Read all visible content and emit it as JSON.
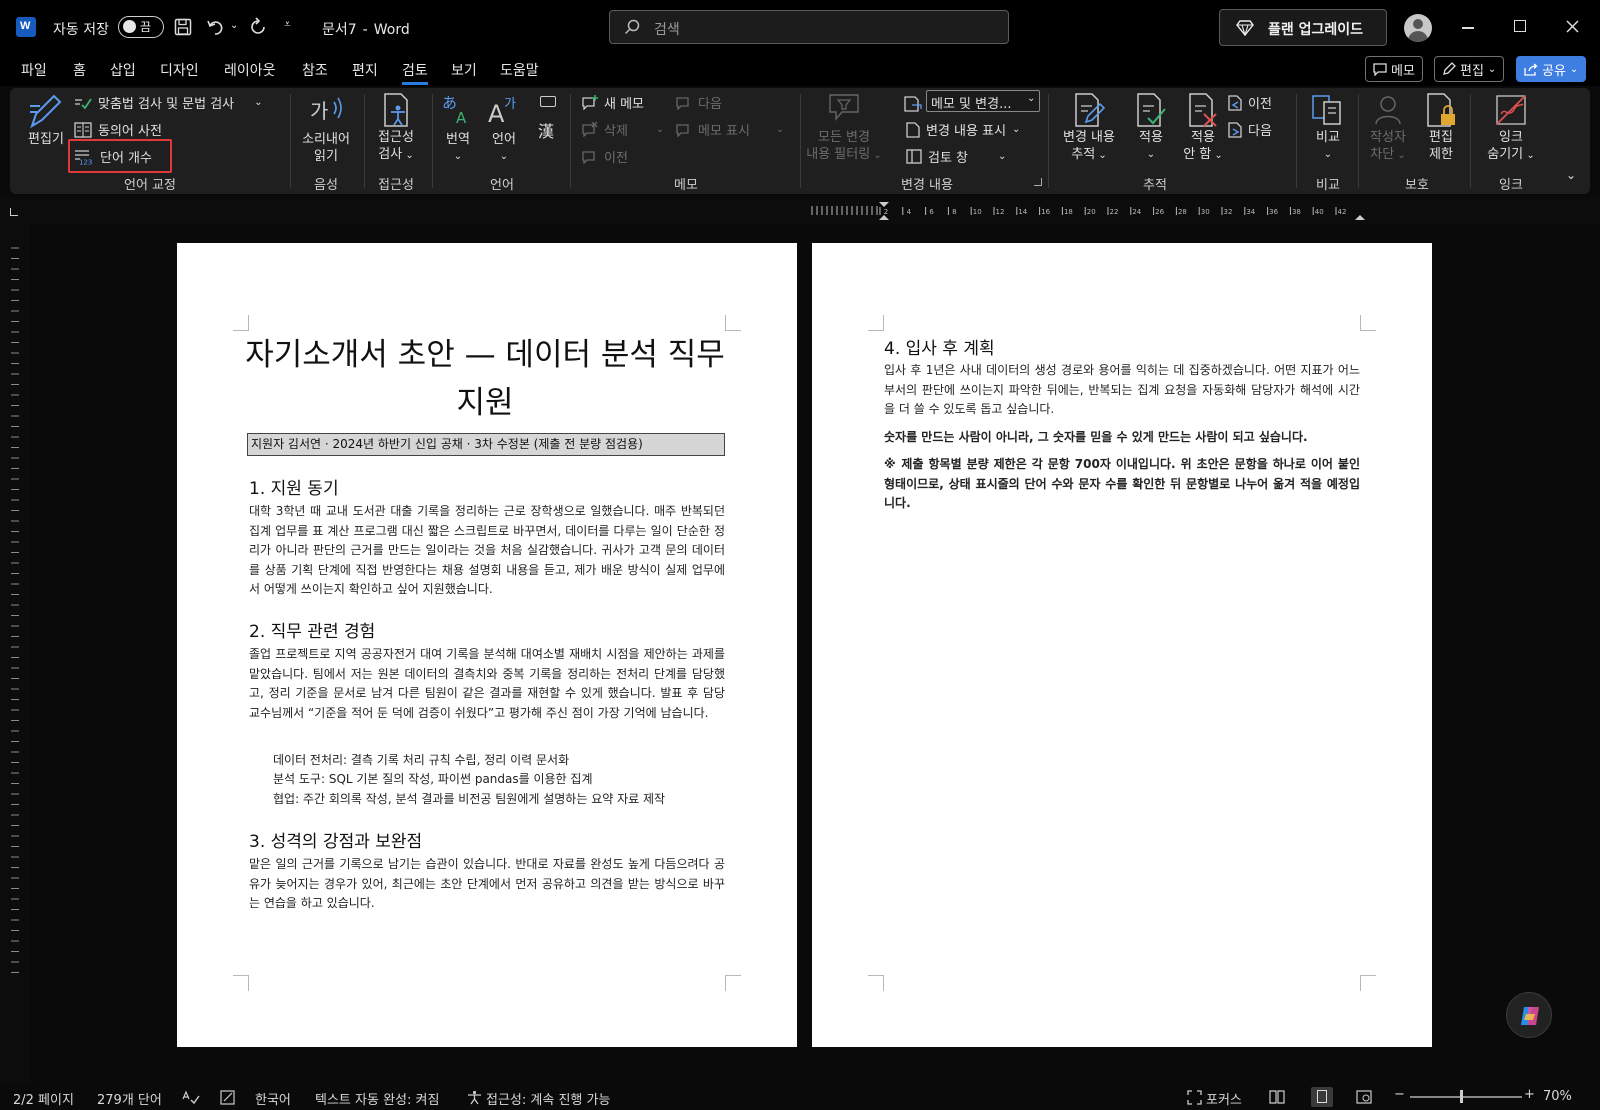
{
  "titlebar": {
    "autosave_label": "자동 저장",
    "autosave_state": "끔",
    "doc_title": "문서7",
    "app_name": "Word",
    "search_placeholder": "검색",
    "upgrade_label": "플랜 업그레이드"
  },
  "menu": {
    "tabs": [
      "파일",
      "홈",
      "삽입",
      "디자인",
      "레이아웃",
      "참조",
      "편지",
      "검토",
      "보기",
      "도움말"
    ],
    "active_tab": "검토",
    "memo_button": "메모",
    "edit_button": "편집",
    "share_button": "공유"
  },
  "ribbon": {
    "proofing": {
      "editor": "편집기",
      "spelling": "맞춤법 검사 및 문법 검사",
      "thesaurus": "동의어 사전",
      "word_count": "단어 개수",
      "label": "언어 교정"
    },
    "speech": {
      "read_aloud_1": "소리내어",
      "read_aloud_2": "읽기",
      "label": "음성"
    },
    "accessibility": {
      "check_1": "접근성",
      "check_2": "검사",
      "label": "접근성"
    },
    "language": {
      "translate": "번역",
      "language": "언어",
      "label": "언어"
    },
    "comments": {
      "new": "새 메모",
      "delete": "삭제",
      "prev": "이전",
      "next": "다음",
      "show": "메모 표시",
      "label": "메모"
    },
    "changes": {
      "filter_1": "모든 변경",
      "filter_2": "내용 필터링",
      "markup_select": "메모 및 변경...",
      "show_markup": "변경 내용 표시",
      "review_pane": "검토 창",
      "label": "변경 내용"
    },
    "tracking": {
      "track_1": "변경 내용",
      "track_2": "추적",
      "accept": "적용",
      "reject_1": "적용",
      "reject_2": "안 함",
      "prev": "이전",
      "next": "다음",
      "label": "추적"
    },
    "compare": {
      "compare": "비교",
      "label": "비교"
    },
    "protect": {
      "block_1": "작성자",
      "block_2": "차단",
      "restrict_1": "편집",
      "restrict_2": "제한",
      "label": "보호"
    },
    "ink": {
      "hide_1": "잉크",
      "hide_2": "숨기기",
      "label": "잉크"
    }
  },
  "ruler": {
    "ticks": [
      "2",
      "4",
      "6",
      "8",
      "10",
      "12",
      "14",
      "16",
      "18",
      "20",
      "22",
      "24",
      "26",
      "28",
      "30",
      "32",
      "34",
      "36",
      "38",
      "40",
      "42"
    ]
  },
  "document": {
    "title": "자기소개서 초안 — 데이터 분석 직무 지원",
    "subtitle": "지원자 김서연 · 2024년 하반기 신입 공채 · 3차 수정본 (제출 전 분량 점검용)",
    "s1_heading": "1. 지원 동기",
    "s1_body": "대학 3학년 때 교내 도서관 대출 기록을 정리하는 근로 장학생으로 일했습니다. 매주 반복되던 집계 업무를 표 계산 프로그램 대신 짧은 스크립트로 바꾸면서, 데이터를 다루는 일이 단순한 정리가 아니라 판단의 근거를 만드는 일이라는 것을 처음 실감했습니다. 귀사가 고객 문의 데이터를 상품 기획 단계에 직접 반영한다는 채용 설명회 내용을 듣고, 제가 배운 방식이 실제 업무에서 어떻게 쓰이는지 확인하고 싶어 지원했습니다.",
    "s2_heading": "2. 직무 관련 경험",
    "s2_body": "졸업 프로젝트로 지역 공공자전거 대여 기록을 분석해 대여소별 재배치 시점을 제안하는 과제를 맡았습니다. 팀에서 저는 원본 데이터의 결측치와 중복 기록을 정리하는 전처리 단계를 담당했고, 정리 기준을 문서로 남겨 다른 팀원이 같은 결과를 재현할 수 있게 했습니다. 발표 후 담당 교수님께서 “기준을 적어 둔 덕에 검증이 쉬웠다”고 평가해 주신 점이 가장 기억에 남습니다.",
    "s2_bullets": [
      "데이터 전처리: 결측 기록 처리 규칙 수립, 정리 이력 문서화",
      "분석 도구: SQL 기본 질의 작성, 파이썬 pandas를 이용한 집계",
      "협업: 주간 회의록 작성, 분석 결과를 비전공 팀원에게 설명하는 요약 자료 제작"
    ],
    "s3_heading": "3. 성격의 강점과 보완점",
    "s3_body": "맡은 일의 근거를 기록으로 남기는 습관이 있습니다. 반대로 자료를 완성도 높게 다듬으려다 공유가 늦어지는 경우가 있어, 최근에는 초안 단계에서 먼저 공유하고 의견을 받는 방식으로 바꾸는 연습을 하고 있습니다.",
    "s4_heading": "4. 입사 후 계획",
    "s4_body": "입사 후 1년은 사내 데이터의 생성 경로와 용어를 익히는 데 집중하겠습니다. 어떤 지표가 어느 부서의 판단에 쓰이는지 파악한 뒤에는, 반복되는 집계 요청을 자동화해 담당자가 해석에 시간을 더 쓸 수 있도록 돕고 싶습니다.",
    "s4_bold": "숫자를 만드는 사람이 아니라, 그 숫자를 믿을 수 있게 만드는 사람이 되고 싶습니다.",
    "note": "※ 제출 항목별 분량 제한은 각 문항 700자 이내입니다. 위 초안은 문항을 하나로 이어 붙인 형태이므로, 상태 표시줄의 단어 수와 문자 수를 확인한 뒤 문항별로 나누어 옮겨 적을 예정입니다."
  },
  "status": {
    "page": "2/2 페이지",
    "words": "279개 단어",
    "language": "한국어",
    "autocomplete": "텍스트 자동 완성: 켜짐",
    "accessibility": "접근성: 계속 진행 가능",
    "focus": "포커스",
    "zoom": "70%"
  },
  "colors": {
    "accent": "#2b7be4",
    "highlight_box": "#e03a3a",
    "ribbon_bg": "#1f1f1f"
  }
}
